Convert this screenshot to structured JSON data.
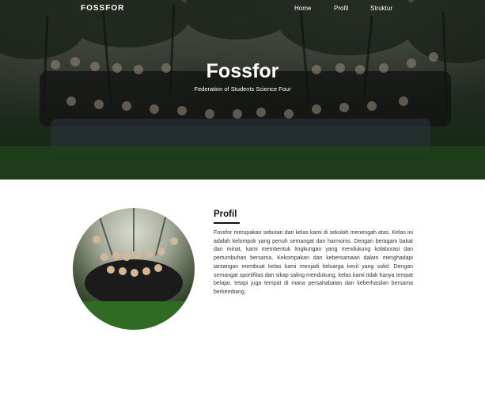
{
  "nav": {
    "brand": "FOSSFOR",
    "links": [
      "Home",
      "Profil",
      "Struktur"
    ]
  },
  "hero": {
    "title": "Fossfor",
    "subtitle": "Federation of Students Science Four"
  },
  "profile": {
    "heading": "Profil",
    "text": "Fossfor merupakan sebutan dari kelas kami di sekolah menengah atas. Kelas ini adalah kelompok yang penuh semangat dan harmonis. Dengan beragam bakat dan minat, kami membentuk lingkungan yang mendukung kolaborasi dan pertumbuhan bersama. Kekompakan dan kebersamaan dalam menghadapi tantangan membuat kelas kami menjadi keluarga kecil yang solid. Dengan semangat sportifitas dan sikap saling mendukung, kelas kami tidak hanya tempat belajar, tetapi juga tempat di mana persahabatan dan keberhasilan bersama berkembang."
  },
  "colors": {
    "hero_overlay": "#2b3a2a",
    "accent": "#111111",
    "background": "#ffffff"
  }
}
